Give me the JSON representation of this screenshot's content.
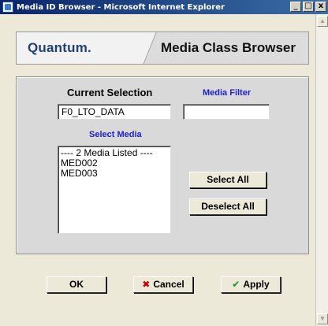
{
  "window": {
    "title": "Media ID Browser - Microsoft Internet Explorer",
    "minimize_label": "_",
    "maximize_label": "□",
    "close_label": "x"
  },
  "banner": {
    "logo": "Quantum",
    "logo_dot": ".",
    "title": "Media Class Browser"
  },
  "selection": {
    "label": "Current Selection",
    "value": "F0_LTO_DATA"
  },
  "filter": {
    "label": "Media Filter",
    "value": ""
  },
  "media_list": {
    "label": "Select Media",
    "items": [
      "---- 2 Media Listed ----",
      "MED002",
      "MED003"
    ]
  },
  "buttons": {
    "select_all": "Select All",
    "deselect_all": "Deselect All",
    "ok": "OK",
    "cancel": "Cancel",
    "apply": "Apply"
  },
  "icons": {
    "cancel": "x-icon",
    "apply": "checkmark-icon",
    "app": "ie-page-icon"
  },
  "colors": {
    "titlebar": "#0a246a",
    "blue_label": "#2020d0",
    "panel": "#d9d9d9",
    "cancel_icon": "#cc0000",
    "apply_icon": "#1f8a1f"
  }
}
